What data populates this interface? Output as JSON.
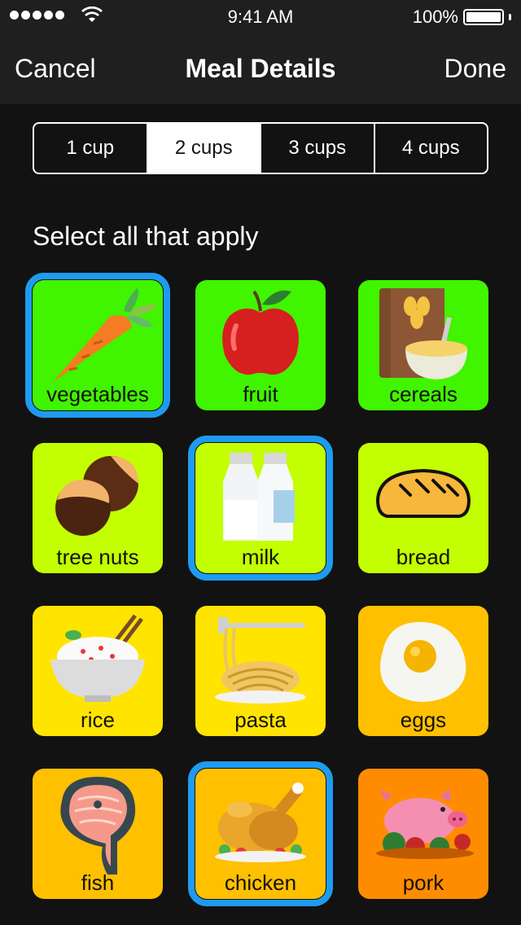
{
  "status": {
    "time": "9:41 AM",
    "battery": "100%"
  },
  "nav": {
    "cancel": "Cancel",
    "title": "Meal Details",
    "done": "Done"
  },
  "portions": {
    "options": [
      "1 cup",
      "2 cups",
      "3 cups",
      "4 cups"
    ],
    "selected": "2 cups"
  },
  "section_label": "Select all that apply",
  "colors": {
    "accent_blue": "#1e9bf0",
    "green": "#41f400",
    "lime": "#c3ff00",
    "yellow": "#ffe400",
    "amber": "#ffc000",
    "orange": "#ff8c00"
  },
  "foods": [
    {
      "label": "vegetables",
      "icon": "carrot-icon",
      "selected": true
    },
    {
      "label": "fruit",
      "icon": "apple-icon",
      "selected": false
    },
    {
      "label": "cereals",
      "icon": "cereal-box-icon",
      "selected": false
    },
    {
      "label": "tree nuts",
      "icon": "chestnut-icon",
      "selected": false
    },
    {
      "label": "milk",
      "icon": "milk-bottle-icon",
      "selected": true
    },
    {
      "label": "bread",
      "icon": "bread-loaf-icon",
      "selected": false
    },
    {
      "label": "rice",
      "icon": "rice-bowl-icon",
      "selected": false
    },
    {
      "label": "pasta",
      "icon": "pasta-plate-icon",
      "selected": false
    },
    {
      "label": "eggs",
      "icon": "fried-egg-icon",
      "selected": false
    },
    {
      "label": "fish",
      "icon": "salmon-steak-icon",
      "selected": false
    },
    {
      "label": "chicken",
      "icon": "roast-chicken-icon",
      "selected": true
    },
    {
      "label": "pork",
      "icon": "pig-icon",
      "selected": false
    }
  ]
}
